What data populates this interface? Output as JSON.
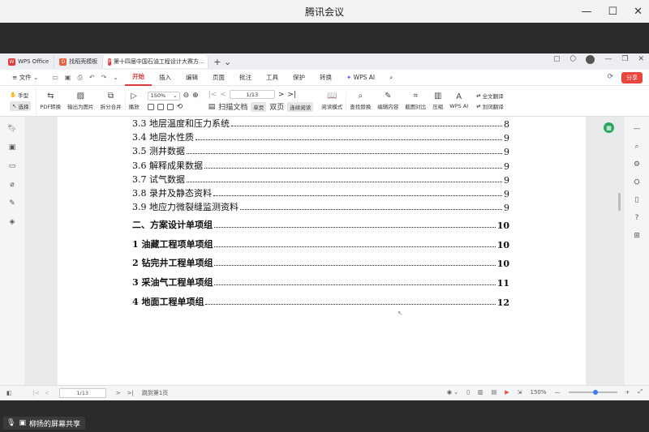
{
  "meeting": {
    "title": "腾讯会议",
    "minimize": "—",
    "maximize": "☐",
    "close": "✕",
    "share_label": "柳扬的屏幕共享"
  },
  "tabs": [
    {
      "label": "WPS Office"
    },
    {
      "label": "找稻壳模板"
    },
    {
      "label": "第十四届中国石油工程设计大赛方..."
    }
  ],
  "menu": {
    "file": "文件",
    "items": [
      "开始",
      "插入",
      "编辑",
      "页面",
      "批注",
      "工具",
      "保护",
      "转换",
      "WPS AI"
    ],
    "share_button": "分享"
  },
  "toolbar": {
    "hand": "手型",
    "select": "选择",
    "pdf_convert": "PDF转换",
    "export_image": "输出为图片",
    "split_merge": "拆分合并",
    "play": "播放",
    "zoom": "150%",
    "page": "1/13",
    "scan_doc": "扫描文档",
    "single_page": "单页",
    "dual_page": "双页",
    "continuous": "连续阅读",
    "reading_mode": "阅读模式",
    "find_replace": "查找替换",
    "edit_content": "编辑内容",
    "screenshot_compare": "截图对比",
    "compress": "压缩",
    "wps_ai": "WPS AI",
    "full_translate": "全文翻译",
    "word_translate": "划词翻译"
  },
  "toc": [
    {
      "text": "3.3 地层温度和压力系统",
      "page": "8",
      "bold": false
    },
    {
      "text": "3.4 地层水性质",
      "page": "9",
      "bold": false
    },
    {
      "text": "3.5 测井数据",
      "page": "9",
      "bold": false
    },
    {
      "text": "3.6 解释成果数据",
      "page": "9",
      "bold": false
    },
    {
      "text": "3.7 试气数据",
      "page": "9",
      "bold": false
    },
    {
      "text": "3.8 录井及静态资料",
      "page": "9",
      "bold": false
    },
    {
      "text": "3.9 地应力微裂缝监测资料",
      "page": "9",
      "bold": false
    },
    {
      "text": "二、方案设计单项组",
      "page": "10",
      "bold": true
    },
    {
      "text": "1 油藏工程项单项组",
      "page": "10",
      "bold": true
    },
    {
      "text": "2 钻完井工程单项组",
      "page": "10",
      "bold": true
    },
    {
      "text": "3 采油气工程单项组",
      "page": "11",
      "bold": true
    },
    {
      "text": "4 地面工程单项组",
      "page": "12",
      "bold": true
    }
  ],
  "statusbar": {
    "page": "1/13",
    "goto": "跳到第1页",
    "zoom": "150%"
  },
  "colors": {
    "accent": "#d83b3b",
    "share_button": "#e8453c",
    "badge": "#27a85b"
  }
}
